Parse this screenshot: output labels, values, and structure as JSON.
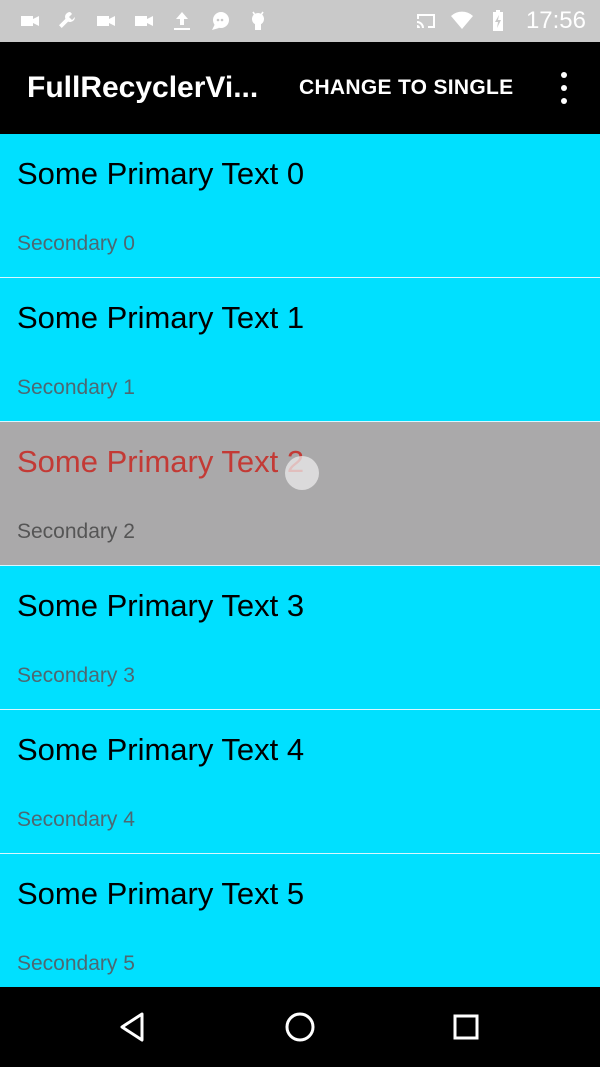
{
  "status_bar": {
    "time": "17:56",
    "left_icons": [
      "video-camera-icon",
      "wrench-icon",
      "video-camera-icon",
      "video-camera-icon",
      "upload-icon",
      "chat-icon",
      "android-icon"
    ],
    "right_icons": [
      "cast-icon",
      "wifi-icon",
      "battery-charging-icon"
    ]
  },
  "app_bar": {
    "title": "FullRecyclerVi...",
    "action_label": "CHANGE TO SINGLE"
  },
  "list": {
    "items": [
      {
        "primary": "Some Primary Text 0",
        "secondary": "Secondary 0"
      },
      {
        "primary": "Some Primary Text 1",
        "secondary": "Secondary 1"
      },
      {
        "primary": "Some Primary Text 2",
        "secondary": "Secondary 2",
        "pressed": true
      },
      {
        "primary": "Some Primary Text 3",
        "secondary": "Secondary 3"
      },
      {
        "primary": "Some Primary Text 4",
        "secondary": "Secondary 4"
      },
      {
        "primary": "Some Primary Text 5",
        "secondary": "Secondary 5"
      }
    ]
  },
  "colors": {
    "list_background": "#00e0ff",
    "pressed_background": "#aaa9aa",
    "pressed_text": "#c33a35",
    "app_bar": "#000000",
    "status_bar": "#c9c9c9"
  },
  "nav_bar": {
    "buttons": [
      "back-icon",
      "home-icon",
      "recents-icon"
    ]
  }
}
